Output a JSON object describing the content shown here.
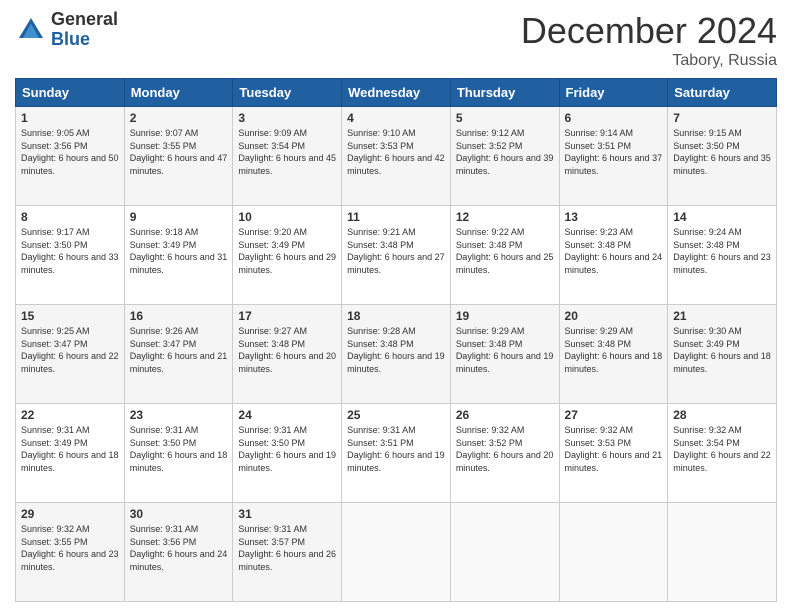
{
  "logo": {
    "general": "General",
    "blue": "Blue"
  },
  "header": {
    "month": "December 2024",
    "location": "Tabory, Russia"
  },
  "weekdays": [
    "Sunday",
    "Monday",
    "Tuesday",
    "Wednesday",
    "Thursday",
    "Friday",
    "Saturday"
  ],
  "weeks": [
    [
      {
        "day": "1",
        "sunrise": "9:05 AM",
        "sunset": "3:56 PM",
        "daylight": "6 hours and 50 minutes."
      },
      {
        "day": "2",
        "sunrise": "9:07 AM",
        "sunset": "3:55 PM",
        "daylight": "6 hours and 47 minutes."
      },
      {
        "day": "3",
        "sunrise": "9:09 AM",
        "sunset": "3:54 PM",
        "daylight": "6 hours and 45 minutes."
      },
      {
        "day": "4",
        "sunrise": "9:10 AM",
        "sunset": "3:53 PM",
        "daylight": "6 hours and 42 minutes."
      },
      {
        "day": "5",
        "sunrise": "9:12 AM",
        "sunset": "3:52 PM",
        "daylight": "6 hours and 39 minutes."
      },
      {
        "day": "6",
        "sunrise": "9:14 AM",
        "sunset": "3:51 PM",
        "daylight": "6 hours and 37 minutes."
      },
      {
        "day": "7",
        "sunrise": "9:15 AM",
        "sunset": "3:50 PM",
        "daylight": "6 hours and 35 minutes."
      }
    ],
    [
      {
        "day": "8",
        "sunrise": "9:17 AM",
        "sunset": "3:50 PM",
        "daylight": "6 hours and 33 minutes."
      },
      {
        "day": "9",
        "sunrise": "9:18 AM",
        "sunset": "3:49 PM",
        "daylight": "6 hours and 31 minutes."
      },
      {
        "day": "10",
        "sunrise": "9:20 AM",
        "sunset": "3:49 PM",
        "daylight": "6 hours and 29 minutes."
      },
      {
        "day": "11",
        "sunrise": "9:21 AM",
        "sunset": "3:48 PM",
        "daylight": "6 hours and 27 minutes."
      },
      {
        "day": "12",
        "sunrise": "9:22 AM",
        "sunset": "3:48 PM",
        "daylight": "6 hours and 25 minutes."
      },
      {
        "day": "13",
        "sunrise": "9:23 AM",
        "sunset": "3:48 PM",
        "daylight": "6 hours and 24 minutes."
      },
      {
        "day": "14",
        "sunrise": "9:24 AM",
        "sunset": "3:48 PM",
        "daylight": "6 hours and 23 minutes."
      }
    ],
    [
      {
        "day": "15",
        "sunrise": "9:25 AM",
        "sunset": "3:47 PM",
        "daylight": "6 hours and 22 minutes."
      },
      {
        "day": "16",
        "sunrise": "9:26 AM",
        "sunset": "3:47 PM",
        "daylight": "6 hours and 21 minutes."
      },
      {
        "day": "17",
        "sunrise": "9:27 AM",
        "sunset": "3:48 PM",
        "daylight": "6 hours and 20 minutes."
      },
      {
        "day": "18",
        "sunrise": "9:28 AM",
        "sunset": "3:48 PM",
        "daylight": "6 hours and 19 minutes."
      },
      {
        "day": "19",
        "sunrise": "9:29 AM",
        "sunset": "3:48 PM",
        "daylight": "6 hours and 19 minutes."
      },
      {
        "day": "20",
        "sunrise": "9:29 AM",
        "sunset": "3:48 PM",
        "daylight": "6 hours and 18 minutes."
      },
      {
        "day": "21",
        "sunrise": "9:30 AM",
        "sunset": "3:49 PM",
        "daylight": "6 hours and 18 minutes."
      }
    ],
    [
      {
        "day": "22",
        "sunrise": "9:31 AM",
        "sunset": "3:49 PM",
        "daylight": "6 hours and 18 minutes."
      },
      {
        "day": "23",
        "sunrise": "9:31 AM",
        "sunset": "3:50 PM",
        "daylight": "6 hours and 18 minutes."
      },
      {
        "day": "24",
        "sunrise": "9:31 AM",
        "sunset": "3:50 PM",
        "daylight": "6 hours and 19 minutes."
      },
      {
        "day": "25",
        "sunrise": "9:31 AM",
        "sunset": "3:51 PM",
        "daylight": "6 hours and 19 minutes."
      },
      {
        "day": "26",
        "sunrise": "9:32 AM",
        "sunset": "3:52 PM",
        "daylight": "6 hours and 20 minutes."
      },
      {
        "day": "27",
        "sunrise": "9:32 AM",
        "sunset": "3:53 PM",
        "daylight": "6 hours and 21 minutes."
      },
      {
        "day": "28",
        "sunrise": "9:32 AM",
        "sunset": "3:54 PM",
        "daylight": "6 hours and 22 minutes."
      }
    ],
    [
      {
        "day": "29",
        "sunrise": "9:32 AM",
        "sunset": "3:55 PM",
        "daylight": "6 hours and 23 minutes."
      },
      {
        "day": "30",
        "sunrise": "9:31 AM",
        "sunset": "3:56 PM",
        "daylight": "6 hours and 24 minutes."
      },
      {
        "day": "31",
        "sunrise": "9:31 AM",
        "sunset": "3:57 PM",
        "daylight": "6 hours and 26 minutes."
      },
      null,
      null,
      null,
      null
    ]
  ]
}
